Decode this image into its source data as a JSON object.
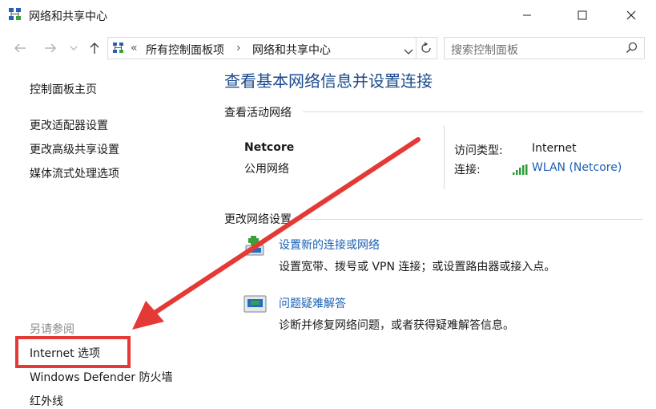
{
  "window": {
    "title": "网络和共享中心",
    "minimize_icon": "minimize-icon",
    "maximize_icon": "maximize-icon",
    "close_icon": "close-icon"
  },
  "address_bar": {
    "prefix": "«",
    "crumbs": [
      "所有控制面板项",
      "网络和共享中心"
    ],
    "search_placeholder": "搜索控制面板"
  },
  "sidebar": {
    "home": "控制面板主页",
    "links": [
      "更改适配器设置",
      "更改高级共享设置",
      "媒体流式处理选项"
    ],
    "see_also_label": "另请参阅",
    "see_also": [
      "Internet 选项",
      "Windows Defender 防火墙",
      "红外线"
    ]
  },
  "main": {
    "title": "查看基本网络信息并设置连接",
    "active_networks_label": "查看活动网络",
    "network": {
      "name": "Netcore",
      "type": "公用网络",
      "access_type_label": "访问类型:",
      "access_type_value": "Internet",
      "connections_label": "连接:",
      "connection_value": "WLAN (Netcore)"
    },
    "change_settings_label": "更改网络设置",
    "tasks": [
      {
        "title": "设置新的连接或网络",
        "desc": "设置宽带、拨号或 VPN 连接；或设置路由器或接入点。",
        "icon": "new-connection-icon"
      },
      {
        "title": "问题疑难解答",
        "desc": "诊断并修复网络问题，或者获得疑难解答信息。",
        "icon": "troubleshoot-icon"
      }
    ]
  },
  "annotation": {
    "color": "#e53935"
  }
}
